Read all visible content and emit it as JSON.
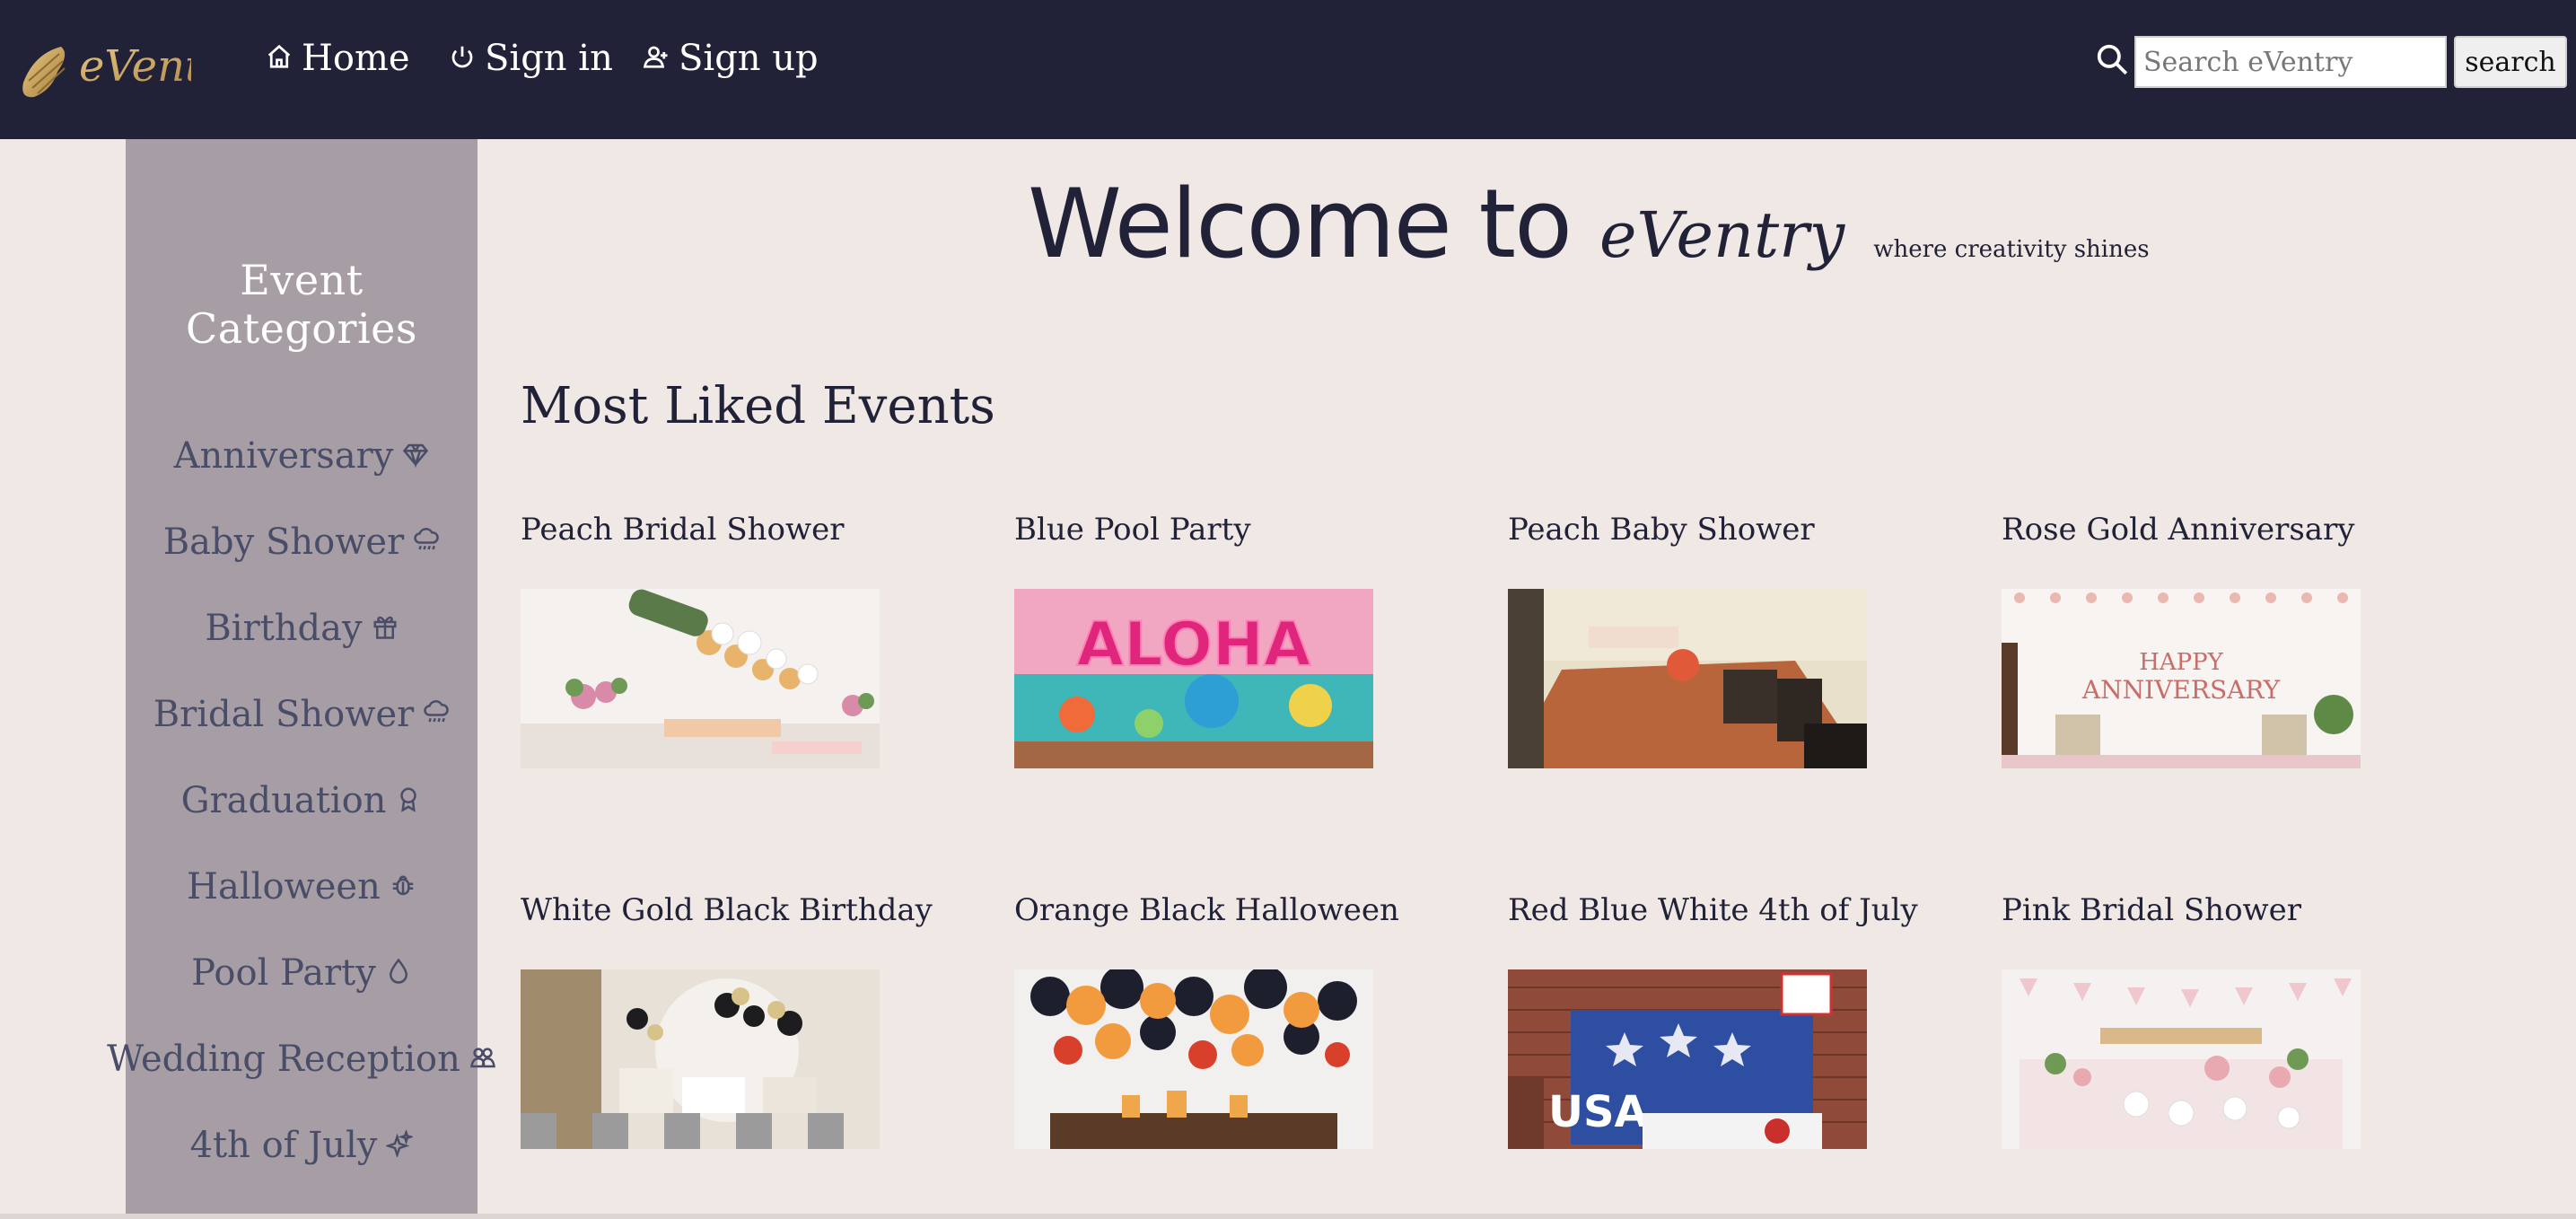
{
  "navbar": {
    "brand": "eVentry",
    "links": [
      {
        "label": "Home",
        "icon": "home-icon"
      },
      {
        "label": "Sign in",
        "icon": "power-icon"
      },
      {
        "label": "Sign up",
        "icon": "person-add-icon"
      }
    ],
    "search": {
      "placeholder": "Search eVentry",
      "value": "",
      "button_label": "search"
    }
  },
  "sidebar": {
    "title": "Event Categories",
    "items": [
      {
        "label": "Anniversary",
        "icon": "gem-icon"
      },
      {
        "label": "Baby Shower",
        "icon": "cloud-drizzle-icon"
      },
      {
        "label": "Birthday",
        "icon": "gift-icon"
      },
      {
        "label": "Bridal Shower",
        "icon": "cloud-drizzle-icon"
      },
      {
        "label": "Graduation",
        "icon": "award-icon"
      },
      {
        "label": "Halloween",
        "icon": "bug-icon"
      },
      {
        "label": "Pool Party",
        "icon": "droplet-icon"
      },
      {
        "label": "Wedding Reception",
        "icon": "people-icon"
      },
      {
        "label": "4th of July",
        "icon": "stars-icon"
      }
    ]
  },
  "hero": {
    "welcome": "Welcome to",
    "brand": "eVentry",
    "tagline": "where creativity shines"
  },
  "main": {
    "section_title": "Most Liked Events",
    "events": [
      {
        "title": "Peach Bridal Shower"
      },
      {
        "title": "Blue Pool Party"
      },
      {
        "title": "Peach Baby Shower"
      },
      {
        "title": "Rose Gold Anniversary"
      },
      {
        "title": "White Gold Black Birthday"
      },
      {
        "title": "Orange Black Halloween"
      },
      {
        "title": "Red Blue White 4th of July"
      },
      {
        "title": "Pink Bridal Shower"
      }
    ]
  },
  "colors": {
    "navbar": "#212238",
    "sidebar": "#a69ea4",
    "page_bg": "#f0e8e4",
    "text_dark": "#212238",
    "sidebar_text": "#4a4d68",
    "brand_gold": "#c9a463"
  }
}
